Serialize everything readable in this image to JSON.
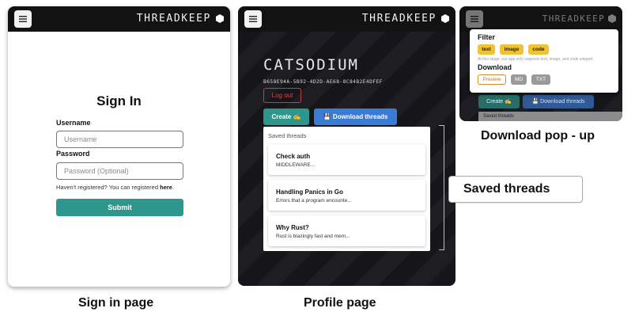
{
  "app": {
    "brand": "THREADKEEP"
  },
  "signin": {
    "title": "Sign In",
    "username_label": "Username",
    "username_placeholder": "Username",
    "password_label": "Password",
    "password_placeholder": "Password (Optional)",
    "register_note": "Haven't registered? You can registered ",
    "register_link": "here",
    "register_end": ".",
    "submit_label": "Submit",
    "caption": "Sign in page"
  },
  "profile": {
    "username": "CATSODIUM",
    "user_id": "B658E94A-5B92-4D2D-AE68-8C84B2E4DFEF",
    "logout_label": "Log out",
    "create_label": "Create ✍",
    "download_label": "Download threads",
    "threads_header": "Saved threads",
    "threads": [
      {
        "title": "Check auth",
        "snippet": "MIDDLEWARE..."
      },
      {
        "title": "Handling Panics in Go",
        "snippet": "Errors that a program encounte..."
      },
      {
        "title": "Why Rust?",
        "snippet": "Rust is blazingly fast and mem..."
      }
    ],
    "caption": "Profile page"
  },
  "popup": {
    "filter_label": "Filter",
    "filters": [
      "text",
      "image",
      "code"
    ],
    "note": "At this stage, our app only supports text, image, and code snippet.",
    "download_label": "Download",
    "formats": [
      "Preview",
      "MD",
      "TXT"
    ],
    "bg_create": "Create ✍",
    "bg_download": "Download threads",
    "bg_saved": "Saved threads",
    "caption": "Download pop - up"
  },
  "callout": {
    "label": "Saved threads"
  },
  "colors": {
    "accent": "#2e978d",
    "download_blue": "#3a7bd5",
    "danger": "#e04646",
    "chip_yellow": "#f1c232",
    "topbar": "#121212"
  }
}
